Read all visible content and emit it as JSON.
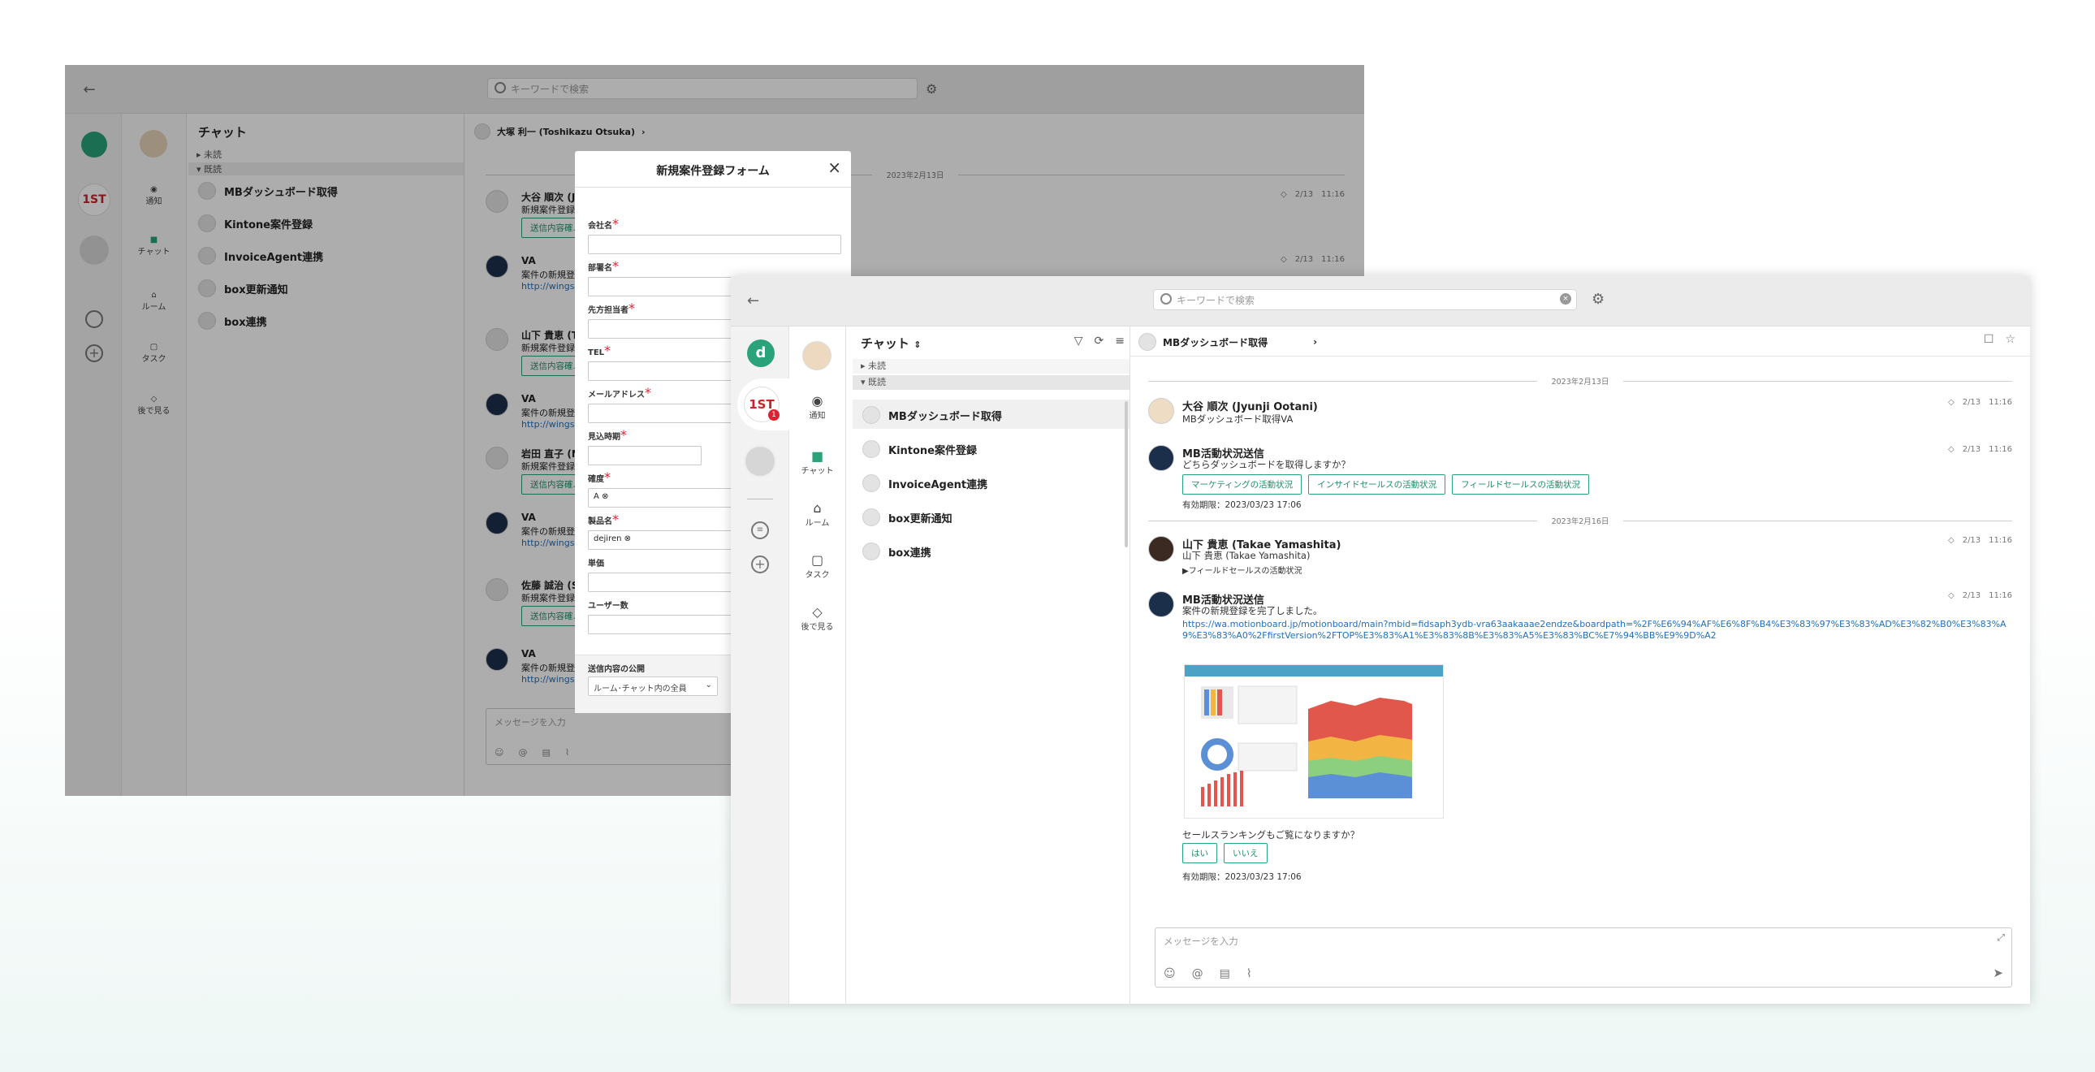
{
  "back_window": {
    "search_placeholder": "キーワードで検索",
    "chat_header": "チャット",
    "room_user": "大塚 利一 (Toshikazu Otsuka)",
    "sections": {
      "unread": "未読",
      "read": "既読"
    },
    "chats": [
      "MBダッシュボード取得",
      "Kintone案件登録",
      "InvoiceAgent連携",
      "box更新通知",
      "box連携"
    ],
    "nav": [
      "通知",
      "チャット",
      "ルーム",
      "タスク",
      "後で見る"
    ],
    "date": "2023年2月13日",
    "messages": [
      {
        "name": "大谷 順次 (J...",
        "text": "新規案件登録...",
        "button": "送信内容確..."
      },
      {
        "name": "VA",
        "text": "案件の新規登...",
        "link": "http://wings..."
      },
      {
        "name": "山下 貴恵 (T...",
        "text": "新規案件登録...",
        "button": "送信内容確..."
      },
      {
        "name": "VA",
        "text": "案件の新規登...",
        "link": "http://wings..."
      },
      {
        "name": "岩田 直子 (N...",
        "text": "新規案件登録...",
        "button": "送信内容確..."
      },
      {
        "name": "VA",
        "text": "案件の新規登...",
        "link": "http://wings..."
      },
      {
        "name": "佐藤 誠治 (S...",
        "text": "新規案件登録...",
        "button": "送信内容確..."
      },
      {
        "name": "VA",
        "text": "案件の新規登...",
        "link": "http://wings..."
      }
    ],
    "meta": [
      "2/13",
      "11:16"
    ],
    "composer_placeholder": "メッセージを入力"
  },
  "form": {
    "title": "新規案件登録フォーム",
    "fields": [
      "会社名",
      "部署名",
      "先方担当者",
      "TEL",
      "メールアドレス",
      "見込時期",
      "確度",
      "製品名",
      "単価",
      "ユーザー数"
    ],
    "required_mark": "*",
    "tag_certainty": "A",
    "tag_product": "dejiren",
    "publish_label": "送信内容の公開",
    "publish_value": "ルーム･チャット内の全員"
  },
  "front_window": {
    "search_placeholder": "キーワードで検索",
    "chat_header": "チャット",
    "room_title": "MBダッシュボード取得",
    "sections": {
      "unread": "未読",
      "read": "既読"
    },
    "chats": [
      "MBダッシュボード取得",
      "Kintone案件登録",
      "InvoiceAgent連携",
      "box更新通知",
      "box連携"
    ],
    "nav": [
      "通知",
      "チャット",
      "ルーム",
      "タスク",
      "後で見る"
    ],
    "badge": "1",
    "dates": [
      "2023年2月13日",
      "2023年2月16日"
    ],
    "meta_date": "2/13",
    "meta_time": "11:16",
    "m1": {
      "name": "大谷 順次 (Jyunji Ootani)",
      "text": "MBダッシュボード取得VA"
    },
    "m2": {
      "name": "MB活動状況送信",
      "text": "どちらダッシュボードを取得しますか？",
      "buttons": [
        "マーケティングの活動状況",
        "インサイドセールスの活動状況",
        "フィールドセールスの活動状況"
      ],
      "expiry": "有効期限：2023/03/23 17:06"
    },
    "m3": {
      "name": "山下 貴恵 (Takae Yamashita)",
      "text": "山下 貴恵 (Takae Yamashita)",
      "toggle": "▶フィールドセールスの活動状況"
    },
    "m4": {
      "name": "MB活動状況送信",
      "text": "案件の新規登録を完了しました。",
      "link": "https://wa.motionboard.jp/motionboard/main?mbid=fidsaph3ydb-vra63aakaaae2endze&boardpath=%2F%E6%94%AF%E6%8F%B4%E3%83%97%E3%83%AD%E3%82%B0%E3%83%A9%E3%83%A0%2FfirstVersion%2FTOP%E3%83%A1%E3%83%8B%E3%83%A5%E3%83%BC%E7%94%BB%E9%9D%A2",
      "question": "セールスランキングもご覧になりますか？",
      "buttons": [
        "はい",
        "いいえ"
      ],
      "expiry": "有効期限：2023/03/23 17:06"
    },
    "composer_placeholder": "メッセージを入力"
  },
  "colors": {
    "brand": "#2aa37a",
    "accent_red": "#c8242b",
    "link": "#1f6fc0"
  }
}
